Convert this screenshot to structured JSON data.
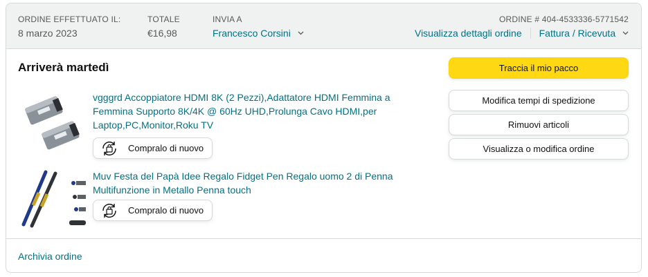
{
  "order_header": {
    "placed_label": "ORDINE EFFETTUATO IL:",
    "placed_date": "8 marzo 2023",
    "total_label": "TOTALE",
    "total_value": "€16,98",
    "ship_to_label": "INVIA A",
    "ship_to_name": "Francesco Corsini",
    "order_number_label": "ORDINE # 404-4533336-5771542",
    "details_link": "Visualizza dettagli ordine",
    "invoice_link": "Fattura / Ricevuta"
  },
  "delivery": {
    "title": "Arriverà martedì"
  },
  "items": [
    {
      "title_line1": "vgggrd Accoppiatore HDMI 8K (2 Pezzi),Adattatore HDMI Femmina a",
      "title_line2": "Femmina Supporto 8K/4K @ 60Hz UHD,Prolunga Cavo HDMI,per",
      "title_line3": "Laptop,PC,Monitor,Roku TV",
      "buy_again_label": "Compralo di nuovo",
      "thumbnail_icon": "hdmi-coupler-image"
    },
    {
      "title_line1": "Muv Festa del Papà Idee Regalo Fidget Pen Regalo uomo 2 di Penna",
      "title_line2": "Multifunzione in Metallo Penna touch",
      "buy_again_label": "Compralo di nuovo",
      "thumbnail_icon": "multitool-pen-image"
    }
  ],
  "actions": {
    "track": "Traccia il mio pacco",
    "modify_shipping": "Modifica tempi di spedizione",
    "remove_items": "Rimuovi articoli",
    "view_modify": "Visualizza o modifica ordine"
  },
  "footer": {
    "archive_link": "Archivia ordine"
  },
  "colors": {
    "link": "#007185",
    "primary_button": "#FFD814",
    "header_bg": "#F0F2F2",
    "border": "#D5D9D9"
  }
}
